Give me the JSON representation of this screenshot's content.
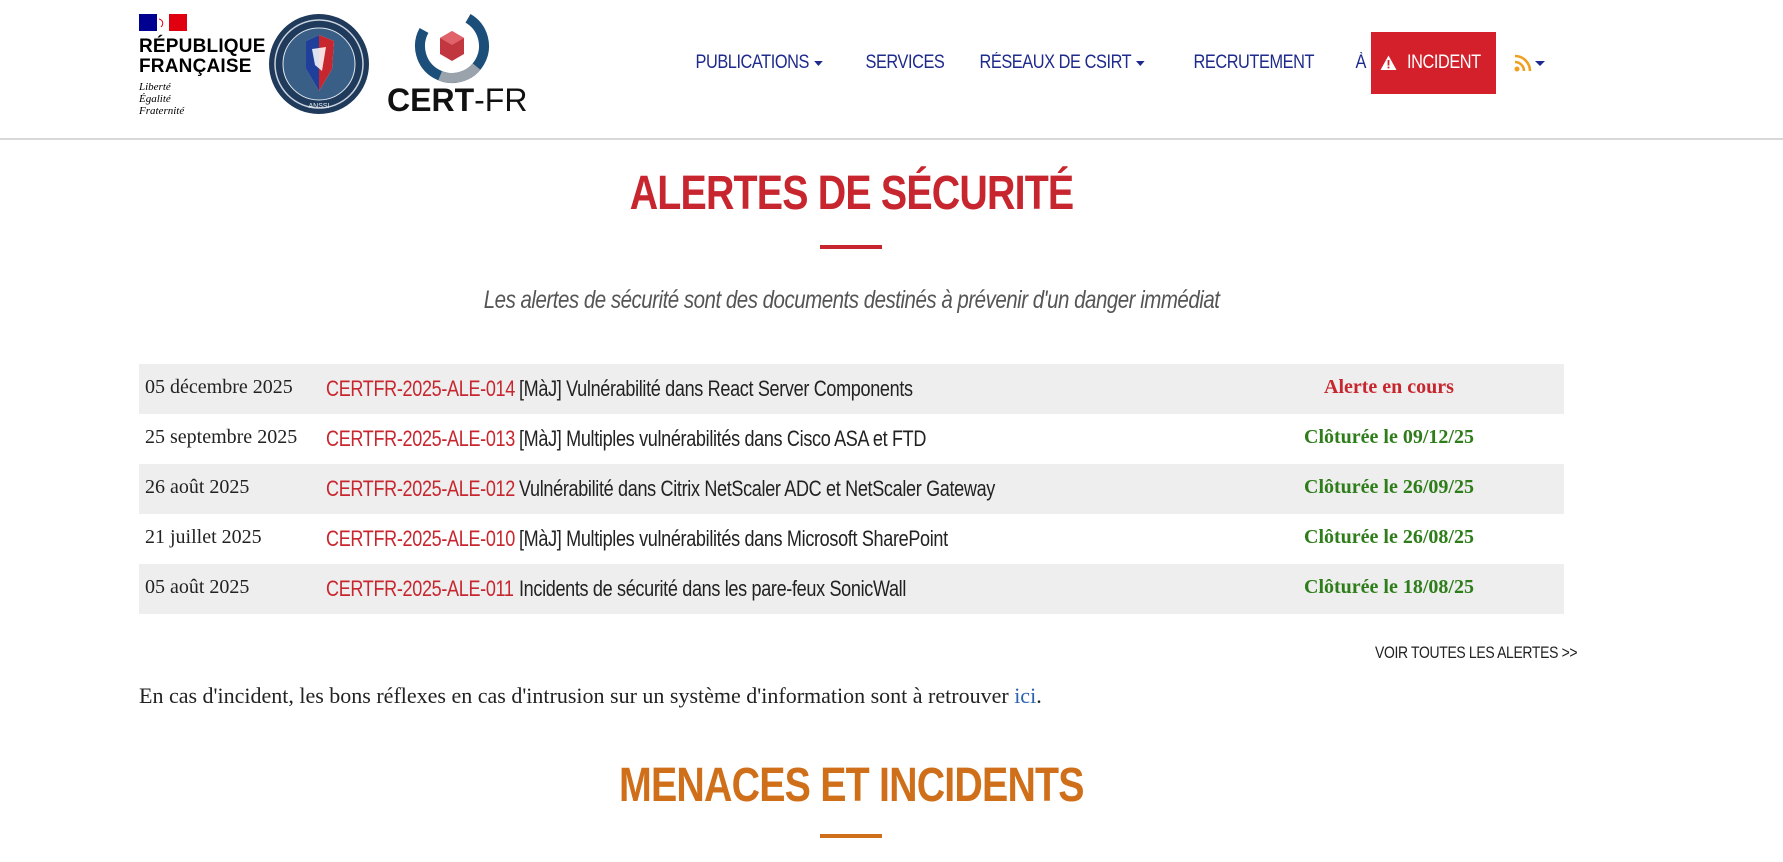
{
  "header": {
    "republique": {
      "line1": "RÉPUBLIQUE",
      "line2": "FRANÇAISE",
      "motto1": "Liberté",
      "motto2": "Égalité",
      "motto3": "Fraternité",
      "flag_colors": [
        "#000091",
        "#ffffff",
        "#e1000f"
      ]
    },
    "anssi_seal_label": "ANSSI",
    "cert_logo": {
      "bold": "CERT",
      "rest": "-FR"
    },
    "nav": [
      {
        "label": "PUBLICATIONS",
        "dropdown": true
      },
      {
        "label": "SERVICES",
        "dropdown": false
      },
      {
        "label": "RÉSEAUX DE CSIRT",
        "dropdown": true
      },
      {
        "label": "RECRUTEMENT",
        "dropdown": false
      },
      {
        "label": "À PROPOS",
        "dropdown": false
      }
    ],
    "incident_button": "INCIDENT",
    "rss_icon": "rss-icon",
    "colors": {
      "nav": "#1e2a8c",
      "incident": "#d3202a",
      "rss": "#f0a020"
    }
  },
  "alerts_section": {
    "title": "ALERTES DE SÉCURITÉ",
    "subtitle": "Les alertes de sécurité sont des documents destinés à prévenir d'un danger immédiat",
    "rows": [
      {
        "date": "05 décembre 2025",
        "ref": "CERTFR-2025-ALE-014",
        "title": "[MàJ] Vulnérabilité dans React Server Components",
        "status": "Alerte en cours",
        "open": true
      },
      {
        "date": "25 septembre 2025",
        "ref": "CERTFR-2025-ALE-013",
        "title": "[MàJ] Multiples vulnérabilités dans Cisco ASA et FTD",
        "status": "Clôturée le 09/12/25",
        "open": false
      },
      {
        "date": "26 août 2025",
        "ref": "CERTFR-2025-ALE-012",
        "title": "Vulnérabilité dans Citrix NetScaler ADC et NetScaler Gateway",
        "status": "Clôturée le 26/09/25",
        "open": false
      },
      {
        "date": "21 juillet 2025",
        "ref": "CERTFR-2025-ALE-010",
        "title": "[MàJ] Multiples vulnérabilités dans Microsoft SharePoint",
        "status": "Clôturée le 26/08/25",
        "open": false
      },
      {
        "date": "05 août 2025",
        "ref": "CERTFR-2025-ALE-011",
        "title": "Incidents de sécurité dans les pare-feux SonicWall",
        "status": "Clôturée le 18/08/25",
        "open": false
      }
    ],
    "see_all": "VOIR TOUTES LES ALERTES >>",
    "note_text": "En cas d'incident, les bons réflexes en cas d'intrusion sur un système d'information sont à retrouver ",
    "note_link": "ici",
    "note_end": ".",
    "colors": {
      "title": "#c8262e",
      "open": "#c8262e",
      "closed": "#2e7d1a"
    }
  },
  "threats_section": {
    "title": "MENACES ET INCIDENTS",
    "color": "#d06f1a"
  }
}
